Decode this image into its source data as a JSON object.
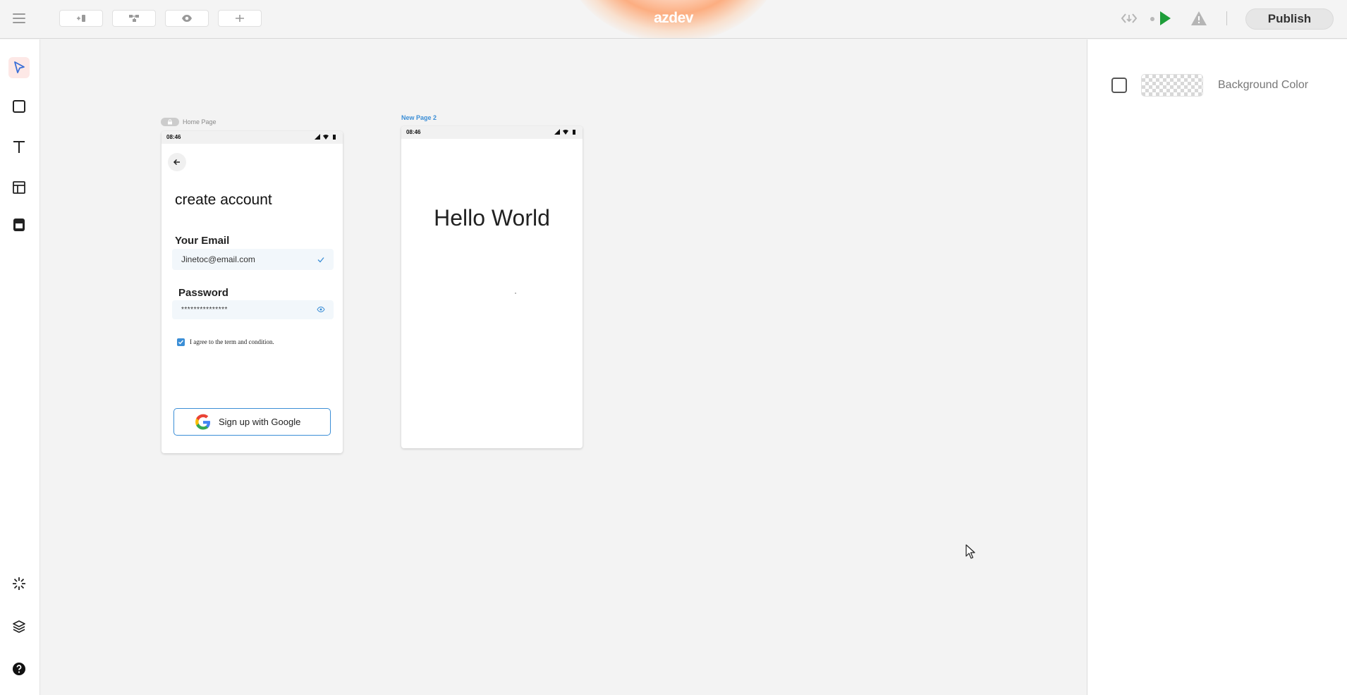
{
  "app": {
    "brand": "azdev",
    "publish_label": "Publish"
  },
  "toolbar": {
    "pills": [
      {
        "icon": "add-page-icon"
      },
      {
        "icon": "flow-icon"
      },
      {
        "icon": "preview-eye-icon"
      },
      {
        "icon": "add-icon"
      }
    ],
    "right_icons": [
      "code-export-icon",
      "play-icon",
      "warning-icon"
    ]
  },
  "left_tools": [
    "select-pointer-icon",
    "rectangle-icon",
    "text-icon",
    "layout-icon",
    "component-icon",
    "magic-icon",
    "layers-icon",
    "help-icon"
  ],
  "right_panel": {
    "background_color_label": "Background Color"
  },
  "canvas": {
    "home_page": {
      "label": "Home Page",
      "status_time": "08:46",
      "title": "create account",
      "email_label": "Your Email",
      "email_value": "Jinetoc@email.com",
      "password_label": "Password",
      "password_value": "***************",
      "agree_label": "I agree to the term and condition.",
      "google_button_label": "Sign up with Google"
    },
    "page_2": {
      "label": "New Page 2",
      "status_time": "08:46",
      "heading": "Hello World"
    }
  },
  "colors": {
    "accent_blue": "#3b8ed6",
    "play_green": "#1e9e3a",
    "active_tool_bg": "#fde8e6"
  }
}
